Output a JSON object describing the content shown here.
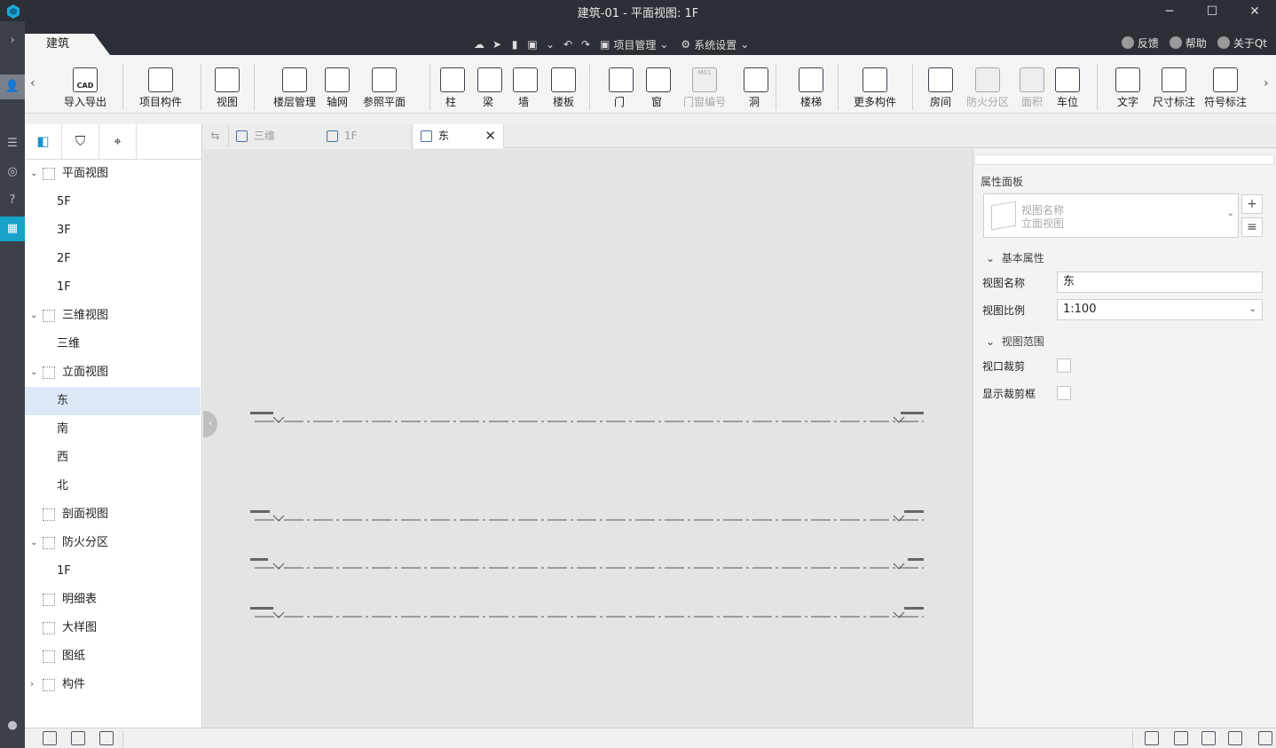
{
  "window": {
    "title": "建筑-01 - 平面视图: 1F",
    "minimize": "─",
    "maximize": "☐",
    "close": "✕"
  },
  "ribbon_tab": "建筑",
  "quickbar": {
    "project_menu": "项目管理",
    "settings_menu": "系统设置"
  },
  "top_links": {
    "feedback": "反馈",
    "help": "帮助",
    "about": "关于Qt"
  },
  "ribbon": {
    "buttons": [
      {
        "label": "导入导出",
        "icon": "cad-import-icon",
        "disabled": false
      },
      {
        "label": "项目构件",
        "icon": "project-component-icon",
        "disabled": false
      },
      {
        "label": "视图",
        "icon": "view-icon",
        "disabled": false
      },
      {
        "label": "楼层管理",
        "icon": "floor-manage-icon",
        "disabled": false
      },
      {
        "label": "轴网",
        "icon": "axis-grid-icon",
        "disabled": false
      },
      {
        "label": "参照平面",
        "icon": "reference-plane-icon",
        "disabled": false
      },
      {
        "label": "柱",
        "icon": "column-icon",
        "disabled": false
      },
      {
        "label": "梁",
        "icon": "beam-icon",
        "disabled": false
      },
      {
        "label": "墙",
        "icon": "wall-icon",
        "disabled": false
      },
      {
        "label": "楼板",
        "icon": "slab-icon",
        "disabled": false
      },
      {
        "label": "门",
        "icon": "door-icon",
        "disabled": false
      },
      {
        "label": "窗",
        "icon": "window-icon",
        "disabled": false
      },
      {
        "label": "门窗编号",
        "icon": "door-window-number-icon",
        "disabled": true
      },
      {
        "label": "洞",
        "icon": "opening-icon",
        "disabled": false
      },
      {
        "label": "楼梯",
        "icon": "stair-icon",
        "disabled": false
      },
      {
        "label": "更多构件",
        "icon": "more-components-icon",
        "disabled": false
      },
      {
        "label": "房间",
        "icon": "room-icon",
        "disabled": false
      },
      {
        "label": "防火分区",
        "icon": "fire-zone-icon",
        "disabled": true
      },
      {
        "label": "面积",
        "icon": "area-icon",
        "disabled": true
      },
      {
        "label": "车位",
        "icon": "parking-icon",
        "disabled": false
      },
      {
        "label": "文字",
        "icon": "text-icon",
        "disabled": false
      },
      {
        "label": "尺寸标注",
        "icon": "dimension-icon",
        "disabled": false
      },
      {
        "label": "符号标注",
        "icon": "symbol-annotation-icon",
        "disabled": false
      }
    ],
    "cad_badge": "CAD",
    "door_number_badge": "M01"
  },
  "tree": {
    "rows": [
      {
        "label": "平面视图",
        "level": 0,
        "expand": "open"
      },
      {
        "label": "5F",
        "level": 1
      },
      {
        "label": "3F",
        "level": 1
      },
      {
        "label": "2F",
        "level": 1
      },
      {
        "label": "1F",
        "level": 1
      },
      {
        "label": "三维视图",
        "level": 0,
        "expand": "open"
      },
      {
        "label": "三维",
        "level": 1
      },
      {
        "label": "立面视图",
        "level": 0,
        "expand": "open"
      },
      {
        "label": "东",
        "level": 1,
        "selected": true
      },
      {
        "label": "南",
        "level": 1
      },
      {
        "label": "西",
        "level": 1
      },
      {
        "label": "北",
        "level": 1
      },
      {
        "label": "剖面视图",
        "level": 0,
        "expand": "none"
      },
      {
        "label": "防火分区",
        "level": 0,
        "expand": "open"
      },
      {
        "label": "1F",
        "level": 1
      },
      {
        "label": "明细表",
        "level": 0,
        "expand": "none"
      },
      {
        "label": "大样图",
        "level": 0,
        "expand": "none"
      },
      {
        "label": "图纸",
        "level": 0,
        "expand": "none"
      },
      {
        "label": "构件",
        "level": 0,
        "expand": "closed"
      }
    ]
  },
  "doc_tabs": [
    {
      "label": "三维",
      "active": false
    },
    {
      "label": "1F",
      "active": false
    },
    {
      "label": "东",
      "active": true
    }
  ],
  "properties": {
    "title": "属性面板",
    "type_selector": {
      "line1": "视图名称",
      "line2": "立面视图"
    },
    "group_basic": "基本属性",
    "view_name_label": "视图名称",
    "view_name_value": "东",
    "view_scale_label": "视图比例",
    "view_scale_value": "1:100",
    "group_range": "视图范围",
    "crop_label": "视口裁剪",
    "show_crop_label": "显示裁剪框"
  }
}
